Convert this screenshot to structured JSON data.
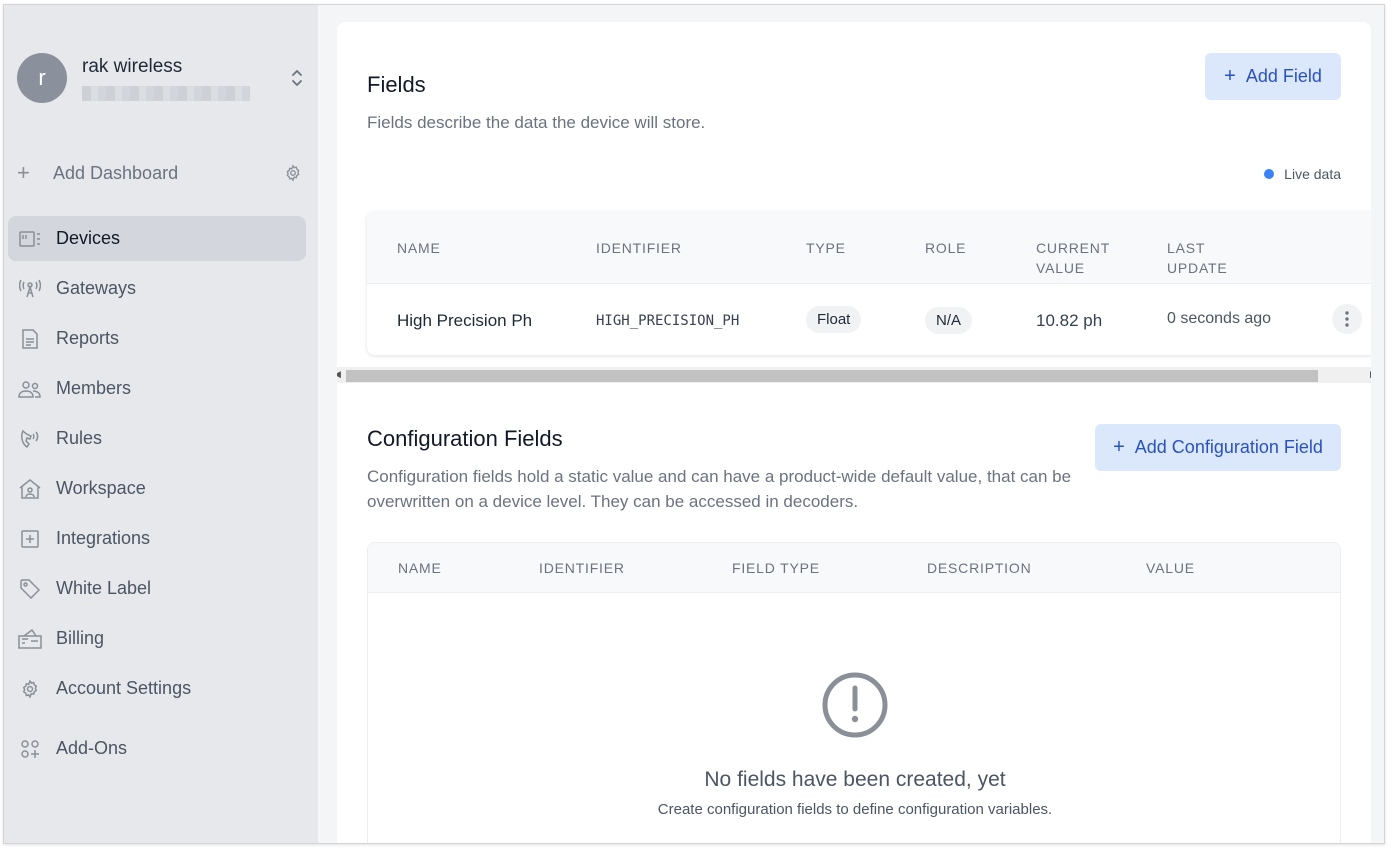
{
  "account": {
    "initial": "r",
    "name": "rak wireless"
  },
  "sidebar": {
    "add_dashboard": "Add Dashboard",
    "items": [
      {
        "label": "Devices",
        "icon": "devices-icon",
        "active": true
      },
      {
        "label": "Gateways",
        "icon": "gateway-icon"
      },
      {
        "label": "Reports",
        "icon": "report-icon"
      },
      {
        "label": "Members",
        "icon": "members-icon"
      },
      {
        "label": "Rules",
        "icon": "rules-icon"
      },
      {
        "label": "Workspace",
        "icon": "workspace-icon"
      },
      {
        "label": "Integrations",
        "icon": "integrations-icon"
      },
      {
        "label": "White Label",
        "icon": "tag-icon"
      },
      {
        "label": "Billing",
        "icon": "billing-icon"
      },
      {
        "label": "Account Settings",
        "icon": "gear-icon"
      },
      {
        "label": "Add-Ons",
        "icon": "add-ons-icon"
      }
    ]
  },
  "fields": {
    "title": "Fields",
    "description": "Fields describe the data the device will store.",
    "add_button": "Add Field",
    "live_label": "Live data",
    "columns": [
      "NAME",
      "IDENTIFIER",
      "TYPE",
      "ROLE",
      "CURRENT\nVALUE",
      "LAST\nUPDATE"
    ],
    "rows": [
      {
        "name": "High Precision Ph",
        "identifier": "HIGH_PRECISION_PH",
        "type": "Float",
        "role": "N/A",
        "current_value": "10.82 ph",
        "last_update": "0 seconds ago"
      }
    ]
  },
  "config": {
    "title": "Configuration Fields",
    "description_line1": "Configuration fields hold a static value and can have a product-wide default value, that can be",
    "description_line2": "overwritten on a device level. They can be accessed in decoders.",
    "add_button": "Add Configuration Field",
    "columns": [
      "NAME",
      "IDENTIFIER",
      "FIELD TYPE",
      "DESCRIPTION",
      "VALUE"
    ],
    "empty_title": "No fields have been created, yet",
    "empty_subtitle": "Create configuration fields to define configuration variables."
  },
  "colors": {
    "accent": "#2a52be",
    "button_bg": "#dbe8fb",
    "live_dot": "#3b82f6",
    "sidebar_bg": "#e6e8ec"
  }
}
